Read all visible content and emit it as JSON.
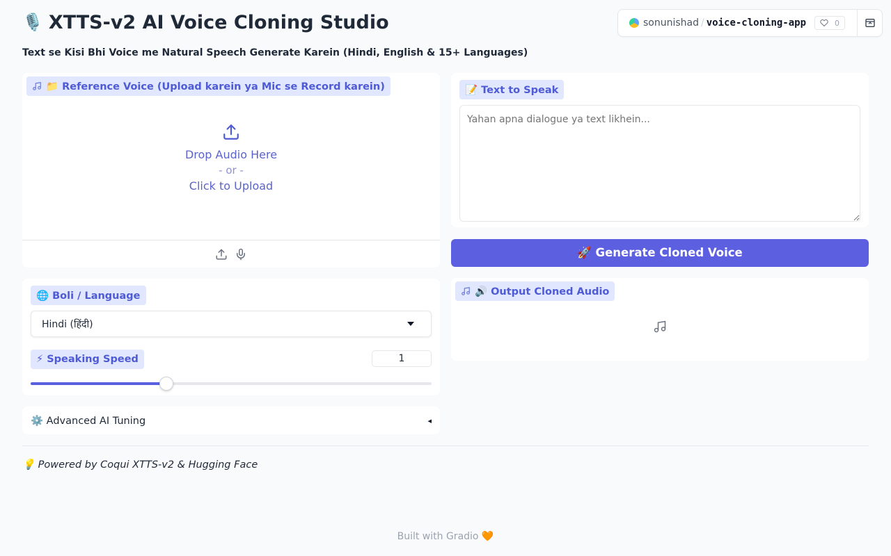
{
  "header": {
    "title_icon": "🎙️",
    "title": "XTTS-v2 AI Voice Cloning Studio",
    "subtitle": "Text se Kisi Bhi Voice me Natural Speech Generate Karein (Hindi, English & 15+ Languages)"
  },
  "hf_badge": {
    "user": "sonunishad",
    "separator": "/",
    "repo": "voice-cloning-app",
    "likes": "0"
  },
  "reference": {
    "label": "📁 Reference Voice (Upload karein ya Mic se Record karein)",
    "drop_text": "Drop Audio Here",
    "or_text": "- or -",
    "click_text": "Click to Upload"
  },
  "language": {
    "label": "🌐 Boli / Language",
    "selected": "Hindi (हिंदी)"
  },
  "speed": {
    "label": "⚡ Speaking Speed",
    "value": "1",
    "slider_fraction": 0.338
  },
  "advanced": {
    "label": "⚙️ Advanced AI Tuning",
    "arrow": "◂"
  },
  "text_input": {
    "label": "📝 Text to Speak",
    "placeholder": "Yahan apna dialogue ya text likhein..."
  },
  "generate": {
    "label": "🚀 Generate Cloned Voice"
  },
  "output": {
    "label": "🔊 Output Cloned Audio"
  },
  "footer": {
    "powered": "💡 Powered by Coqui XTTS-v2 & Hugging Face",
    "built": "Built with Gradio 🧡"
  },
  "colors": {
    "accent": "#5b5fe0",
    "chip_bg": "#e0e7ff",
    "chip_text": "#4f5bd5"
  }
}
